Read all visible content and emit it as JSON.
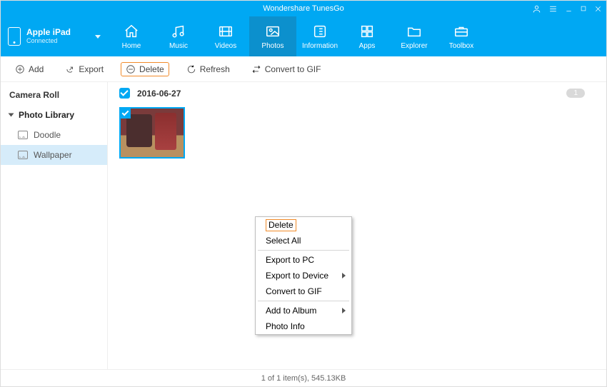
{
  "app_title": "Wondershare TunesGo",
  "device": {
    "name": "Apple iPad",
    "status": "Connected"
  },
  "tabs": [
    {
      "label": "Home"
    },
    {
      "label": "Music"
    },
    {
      "label": "Videos"
    },
    {
      "label": "Photos"
    },
    {
      "label": "Information"
    },
    {
      "label": "Apps"
    },
    {
      "label": "Explorer"
    },
    {
      "label": "Toolbox"
    }
  ],
  "toolbar": {
    "add": "Add",
    "export": "Export",
    "delete": "Delete",
    "refresh": "Refresh",
    "convert": "Convert to GIF"
  },
  "sidebar": {
    "camera_roll": "Camera Roll",
    "photo_library": "Photo Library",
    "doodle": "Doodle",
    "wallpaper": "Wallpaper"
  },
  "group": {
    "date": "2016-06-27",
    "count": "1"
  },
  "context_menu": {
    "delete": "Delete",
    "select_all": "Select All",
    "export_pc": "Export to PC",
    "export_device": "Export to Device",
    "convert": "Convert to GIF",
    "add_album": "Add to Album",
    "photo_info": "Photo Info"
  },
  "status": "1 of 1 item(s), 545.13KB"
}
